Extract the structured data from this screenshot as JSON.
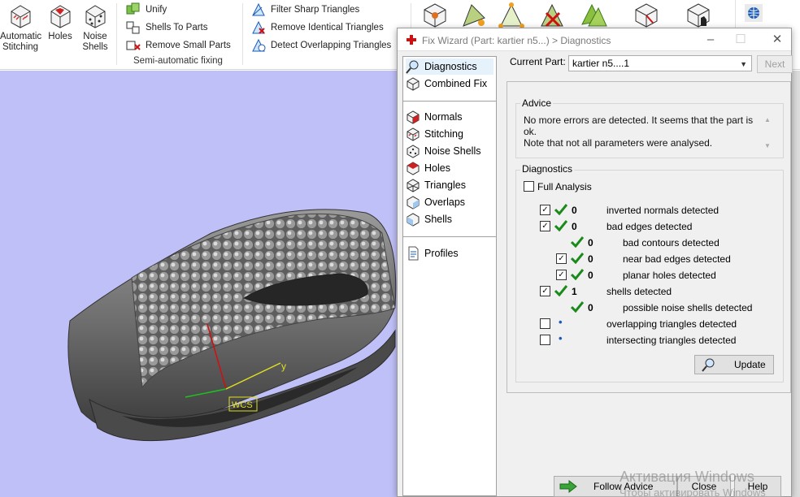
{
  "ribbon": {
    "automatic_stitching": "Automatic\nStitching",
    "holes": "Holes",
    "noise_shells": "Noise\nShells",
    "unify": "Unify",
    "shells_to_parts": "Shells To Parts",
    "remove_small_parts": "Remove Small Parts",
    "group_label": "Semi-automatic fixing",
    "filter_sharp_triangles": "Filter Sharp Triangles",
    "remove_identical_triangles": "Remove Identical Triangles",
    "detect_overlapping_triangles": "Detect Overlapping Triangles"
  },
  "viewport": {
    "axis_y_label": "y",
    "axis_wcs_label": "WCS"
  },
  "dialog": {
    "title": "Fix Wizard (Part: kartier n5...) > Diagnostics",
    "current_part_label": "Current Part:",
    "current_part_value": "kartier n5....1",
    "next_button": "Next",
    "left_items": [
      {
        "label": "Diagnostics"
      },
      {
        "label": "Combined Fix"
      },
      {
        "label": "Normals"
      },
      {
        "label": "Stitching"
      },
      {
        "label": "Noise Shells"
      },
      {
        "label": "Holes"
      },
      {
        "label": "Triangles"
      },
      {
        "label": "Overlaps"
      },
      {
        "label": "Shells"
      },
      {
        "label": "Profiles"
      }
    ],
    "advice_group": "Advice",
    "advice_text": "No more errors are detected. It seems that the part is ok.\nNote that not all parameters were analysed.",
    "diagnostics_group": "Diagnostics",
    "full_analysis": "Full Analysis",
    "rows": [
      {
        "count": "0",
        "text": "inverted normals detected"
      },
      {
        "count": "0",
        "text": "bad edges detected"
      },
      {
        "count": "0",
        "text": "bad contours detected"
      },
      {
        "count": "0",
        "text": "near bad edges detected"
      },
      {
        "count": "0",
        "text": "planar holes detected"
      },
      {
        "count": "1",
        "text": "shells detected"
      },
      {
        "count": "0",
        "text": "possible noise shells detected"
      },
      {
        "count": "",
        "text": "overlapping triangles detected"
      },
      {
        "count": "",
        "text": "intersecting triangles detected"
      }
    ],
    "update_button": "Update",
    "follow_advice_button": "Follow Advice",
    "close_button": "Close",
    "help_button": "Help"
  },
  "watermark": {
    "line1": "Активация Windows",
    "line2": "Чтобы активировать Windows"
  },
  "colors": {
    "viewport_bg": "#c0c0f8",
    "check_green": "#1a8a1a",
    "close_red": "#d01010"
  }
}
